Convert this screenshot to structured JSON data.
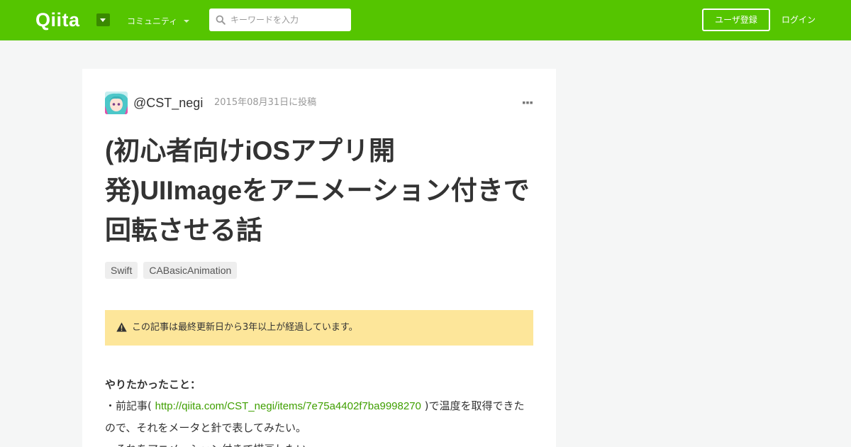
{
  "header": {
    "logo": "Qiita",
    "community_label": "コミュニティ",
    "search_placeholder": "キーワードを入力",
    "search_value": "",
    "signup_label": "ユーザ登録",
    "login_label": "ログイン",
    "colors": {
      "brand": "#55c500",
      "dropdown_bg": "#3a8a00"
    },
    "icons": [
      "chevron-down-icon",
      "search-icon"
    ]
  },
  "article": {
    "author": "@CST_negi",
    "posted_date": "2015年08月31日に投稿",
    "title": "(初心者向けiOSアプリ開発)UIImageをアニメーション付きで回転させる話",
    "tags": [
      "Swift",
      "CABasicAnimation"
    ],
    "alert": {
      "text": "この記事は最終更新日から3年以上が経過しています。",
      "icon": "warning-icon",
      "background": "#fde69a"
    },
    "body": {
      "heading": "やりたかったこと：",
      "line1_prefix": "・前記事( ",
      "line1_link": "http://qiita.com/CST_negi/items/7e75a4402f7ba9998270",
      "line1_suffix": " )で温度を取得できたので、それをメータと針で表してみたい。",
      "line2": "・それをアニメーション付きで描画したい。",
      "link_color": "#3f9f00"
    }
  }
}
